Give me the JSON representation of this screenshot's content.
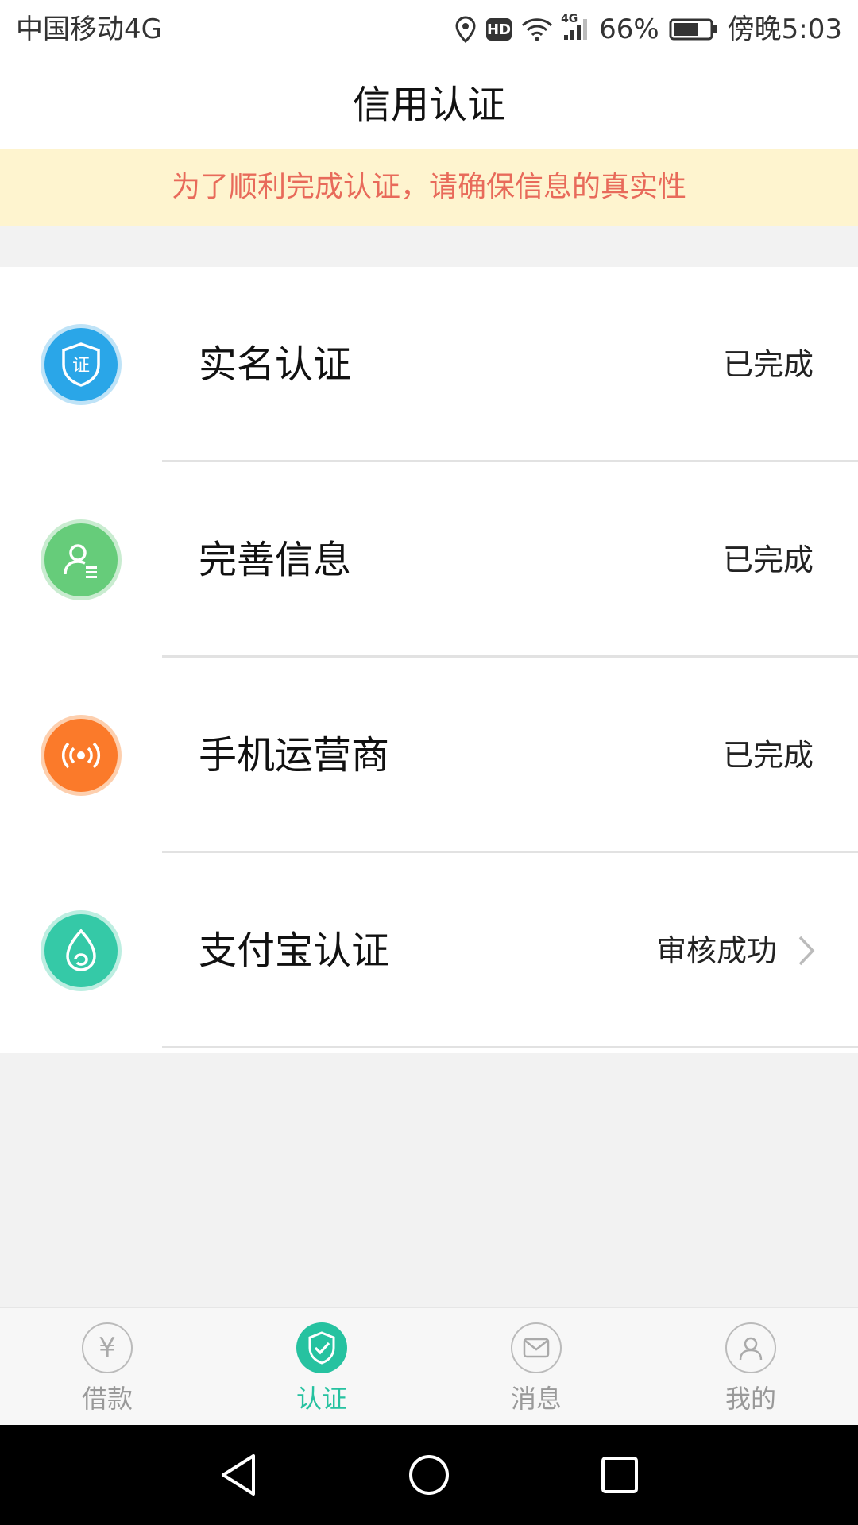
{
  "status_bar": {
    "carrier": "中国移动4G",
    "network_small": "4G",
    "battery_percent": "66%",
    "time": "傍晚5:03",
    "hd": "HD"
  },
  "header": {
    "title": "信用认证"
  },
  "notice": {
    "text": "为了顺利完成认证，请确保信息的真实性"
  },
  "cert_items": [
    {
      "label": "实名认证",
      "status": "已完成",
      "icon": "shield-cert-icon",
      "icon_glyph": "证",
      "color": "#2aa6e8"
    },
    {
      "label": "完善信息",
      "status": "已完成",
      "icon": "user-info-icon",
      "color": "#66cc7a"
    },
    {
      "label": "手机运营商",
      "status": "已完成",
      "icon": "signal-broadcast-icon",
      "color": "#fb7a2a"
    },
    {
      "label": "支付宝认证",
      "status": "审核成功",
      "icon": "alipay-icon",
      "color": "#35c9a7"
    }
  ],
  "tabs": [
    {
      "label": "借款",
      "icon": "yuan-icon",
      "active": false,
      "glyph": "¥"
    },
    {
      "label": "认证",
      "icon": "shield-check-icon",
      "active": true
    },
    {
      "label": "消息",
      "icon": "mail-icon",
      "active": false
    },
    {
      "label": "我的",
      "icon": "person-icon",
      "active": false
    }
  ],
  "colors": {
    "accent": "#26c2a0",
    "notice_bg": "#fef4cf",
    "notice_text": "#e86a5a",
    "tab_inactive": "#999999"
  }
}
